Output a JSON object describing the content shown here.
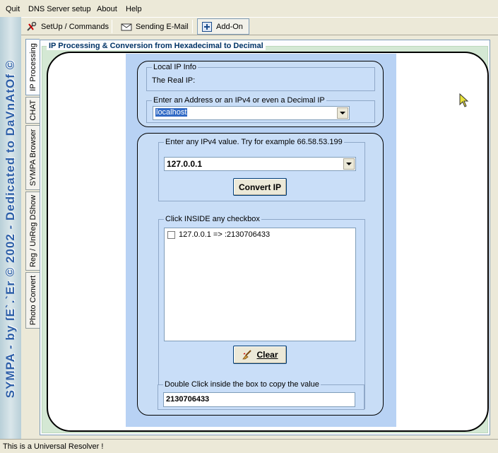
{
  "menu": [
    "Quit",
    "DNS Server setup",
    "About",
    "Help"
  ],
  "toolbar": {
    "setup": "SetUp / Commands",
    "email": "Sending E-Mail",
    "addon": "Add-On"
  },
  "banner": "SYMPA - by ſE`.`Er © 2002 - Dedicated to DaVnAtOf ©",
  "tabs": [
    "IP Processing",
    "CHAT",
    "SYMPA Browser",
    "Reg / UnReg DShow",
    "Photo Convert"
  ],
  "main": {
    "group_title": "IP Processing & Conversion from Hexadecimal to Decimal",
    "local_info": {
      "legend": "Local IP Info",
      "real_ip_label": "The Real IP:"
    },
    "address": {
      "legend": "Enter an Address or an IPv4 or even a Decimal IP",
      "value": "localhost"
    },
    "ipv4": {
      "legend": "Enter any IPv4 value.  Try for example 66.58.53.199",
      "value": "127.0.0.1",
      "convert_label": "Convert IP"
    },
    "checkbox_list": {
      "legend": "Click INSIDE any checkbox",
      "items": [
        "127.0.0.1  => :2130706433"
      ]
    },
    "clear_label": "Clear",
    "copy": {
      "legend": "Double Click inside the box to copy the value",
      "value": "2130706433"
    }
  },
  "status": "This is a Universal Resolver !",
  "colors": {
    "panel": "#b8d2f4",
    "banner_text": "#2d5fa8"
  }
}
